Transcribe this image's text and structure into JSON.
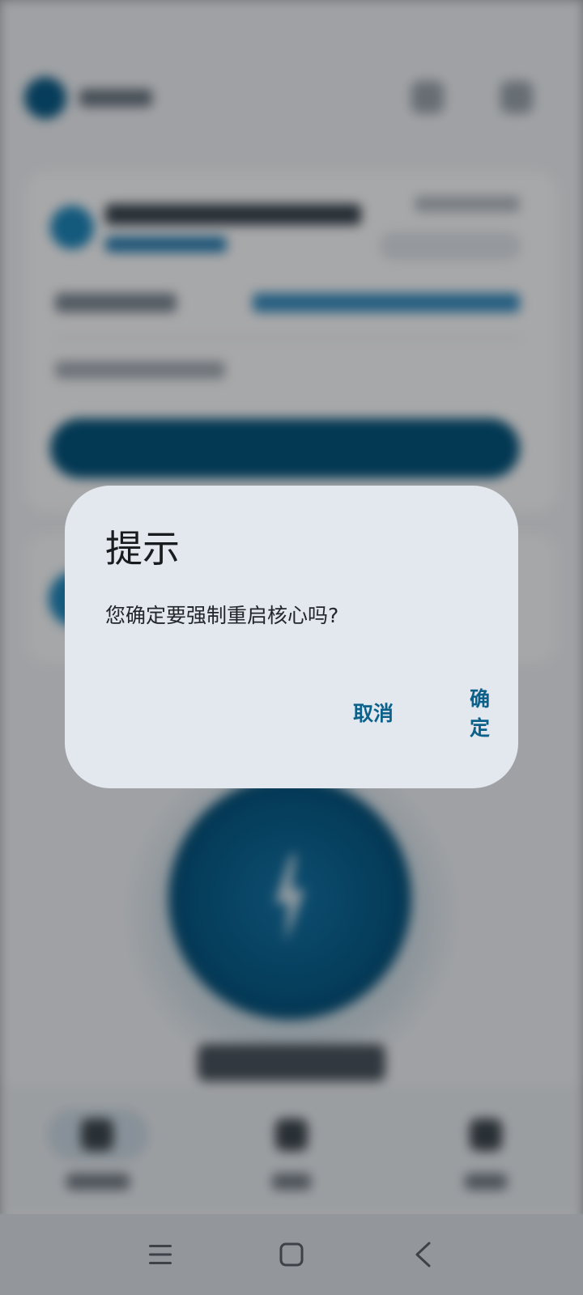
{
  "dialog": {
    "title": "提示",
    "message": "您确定要强制重启核心吗?",
    "cancel_label": "取消",
    "confirm_label": "确定"
  },
  "colors": {
    "accent": "#0b6189",
    "dialog_background": "#e3e8ef",
    "scrim": "rgba(0,0,0,0.33)"
  },
  "icons": {
    "power_button": "lightning-bolt-icon",
    "system_nav": [
      "recents-menu-icon",
      "home-square-icon",
      "back-chevron-icon"
    ]
  }
}
